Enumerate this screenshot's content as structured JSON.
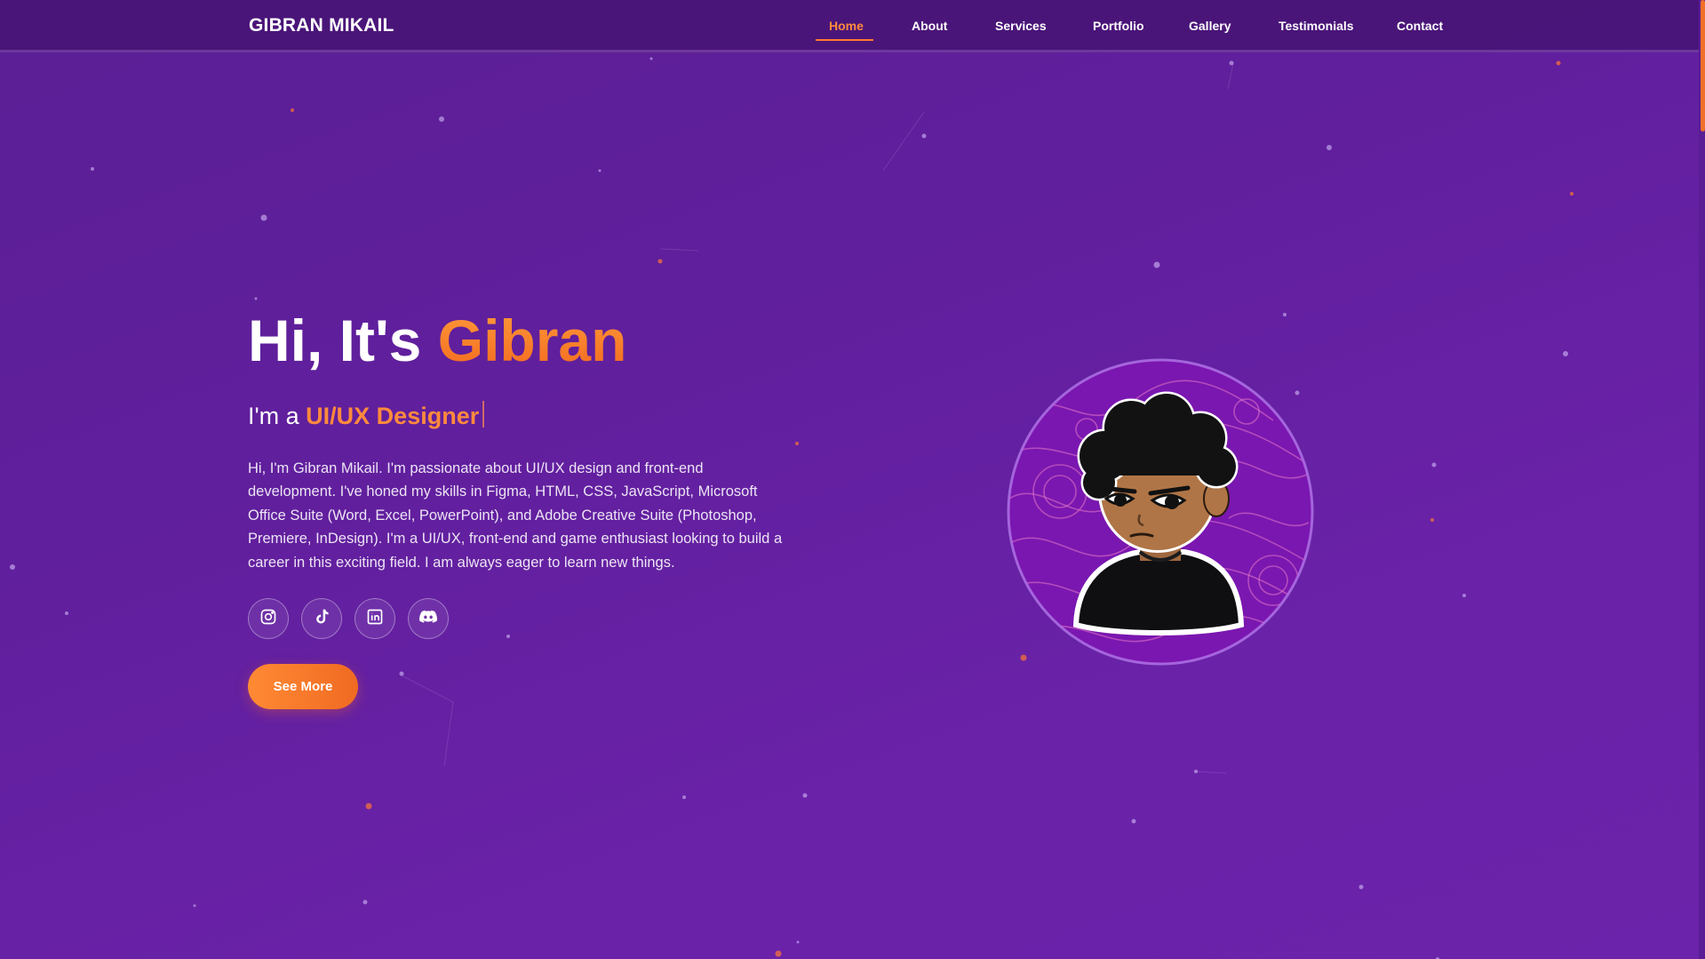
{
  "nav": {
    "brand": "GIBRAN MIKAIL",
    "links": [
      {
        "label": "Home",
        "active": true
      },
      {
        "label": "About",
        "active": false
      },
      {
        "label": "Services",
        "active": false
      },
      {
        "label": "Portfolio",
        "active": false
      },
      {
        "label": "Gallery",
        "active": false
      },
      {
        "label": "Testimonials",
        "active": false
      },
      {
        "label": "Contact",
        "active": false
      }
    ]
  },
  "hero": {
    "greeting": "Hi, It's ",
    "name": "Gibran",
    "subtitle_prefix": "I'm a ",
    "role": "UI/UX Designer",
    "bio": "Hi, I'm Gibran Mikail. I'm passionate about UI/UX design and front-end development. I've honed my skills in Figma, HTML, CSS, JavaScript, Microsoft Office Suite (Word, Excel, PowerPoint), and Adobe Creative Suite (Photoshop, Premiere, InDesign). I'm a UI/UX, front-end and game enthusiast looking to build a career in this exciting field. I am always eager to learn new things.",
    "cta_label": "See More",
    "socials": [
      {
        "icon": "instagram-icon"
      },
      {
        "icon": "tiktok-icon"
      },
      {
        "icon": "linkedin-icon"
      },
      {
        "icon": "discord-icon"
      }
    ],
    "avatar_icon": "cartoon-avatar"
  },
  "colors": {
    "background": "#611f9e",
    "accent": "#ff8a3d",
    "nav_background": "#46147a"
  }
}
